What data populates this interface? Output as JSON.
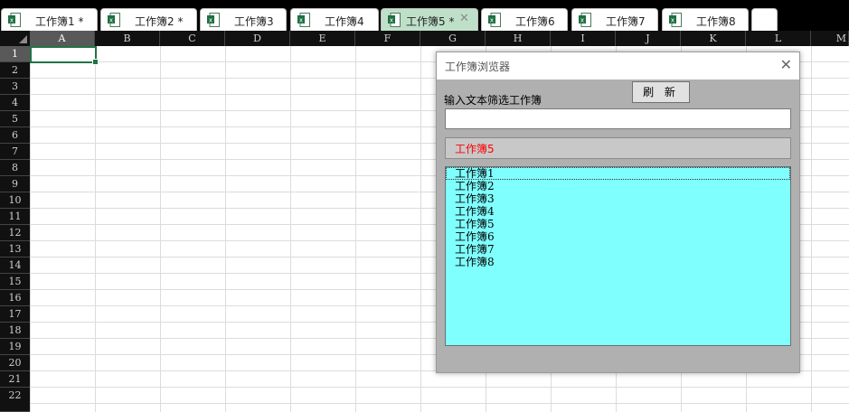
{
  "tabs": [
    {
      "label": "工作簿1 *",
      "active": false
    },
    {
      "label": "工作簿2 *",
      "active": false
    },
    {
      "label": "工作簿3",
      "active": false
    },
    {
      "label": "工作簿4",
      "active": false
    },
    {
      "label": "工作簿5 *",
      "active": true,
      "close": "✕"
    },
    {
      "label": "工作簿6",
      "active": false
    },
    {
      "label": "工作簿7",
      "active": false
    },
    {
      "label": "工作簿8",
      "active": false
    }
  ],
  "columns": [
    "A",
    "B",
    "C",
    "D",
    "E",
    "F",
    "G",
    "H",
    "I",
    "J",
    "K",
    "L",
    "M"
  ],
  "rows": [
    "1",
    "2",
    "3",
    "4",
    "5",
    "6",
    "7",
    "8",
    "9",
    "10",
    "11",
    "12",
    "13",
    "14",
    "15",
    "16",
    "17",
    "18",
    "19",
    "20",
    "21",
    "22"
  ],
  "selected_cell": {
    "column": "A",
    "row": "1"
  },
  "dialog": {
    "title": "工作簿浏览器",
    "close_icon": "✕",
    "refresh_label": "刷 新",
    "filter_label": "输入文本筛选工作簿",
    "filter_value": "",
    "current_workbook": "工作簿5",
    "workbooks": [
      "工作簿1",
      "工作簿2",
      "工作簿3",
      "工作簿4",
      "工作簿5",
      "工作簿6",
      "工作簿7",
      "工作簿8"
    ]
  },
  "colors": {
    "accent": "#217346",
    "active_tab": "#bfe0c8",
    "list_background": "#80ffff",
    "current_text": "#ff0000"
  }
}
